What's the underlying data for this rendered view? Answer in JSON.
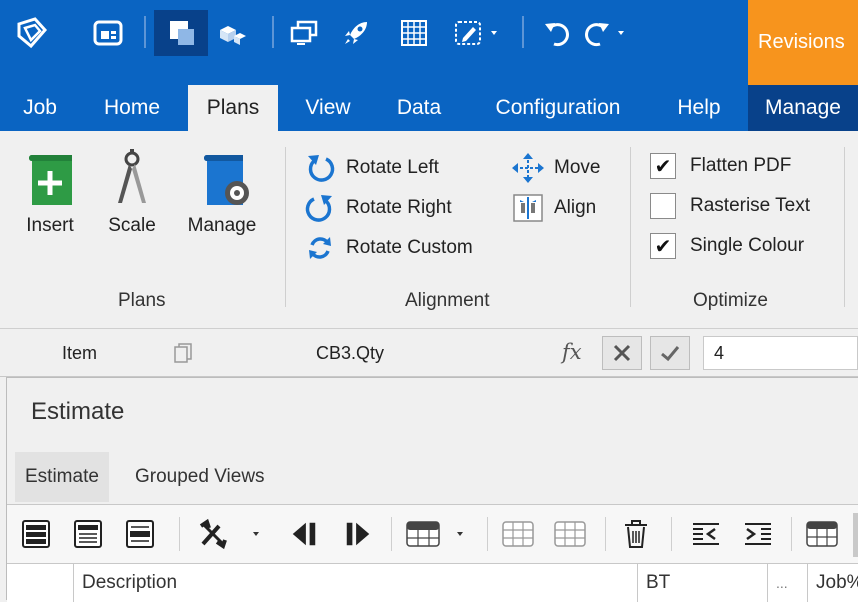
{
  "revisions_label": "Revisions",
  "tabs": [
    "Job",
    "Home",
    "Plans",
    "View",
    "Data",
    "Configuration",
    "Help",
    "Manage"
  ],
  "ribbon": {
    "plans": {
      "insert": "Insert",
      "scale": "Scale",
      "manage": "Manage",
      "label": "Plans"
    },
    "alignment": {
      "rotate_left": "Rotate Left",
      "rotate_right": "Rotate Right",
      "rotate_custom": "Rotate Custom",
      "move": "Move",
      "align": "Align",
      "label": "Alignment"
    },
    "optimize": {
      "flatten_pdf": "Flatten PDF",
      "rasterise_text": "Rasterise Text",
      "single_colour": "Single Colour",
      "label": "Optimize",
      "flatten_checked": true,
      "rasterise_checked": false,
      "single_checked": true
    }
  },
  "formula_bar": {
    "item": "Item",
    "cell": "CB3.Qty",
    "fx": "fx",
    "value": "4"
  },
  "panel": {
    "title": "Estimate",
    "subtabs": [
      "Estimate",
      "Grouped Views"
    ],
    "columns": {
      "description": "Description",
      "bt": "BT",
      "more": "...",
      "job": "Job%"
    }
  },
  "colors": {
    "ribbon_blue": "#0a64c2",
    "dark_blue": "#08418a",
    "orange": "#f7941d",
    "green": "#2e9b45",
    "icon_blue": "#1b75d0"
  }
}
